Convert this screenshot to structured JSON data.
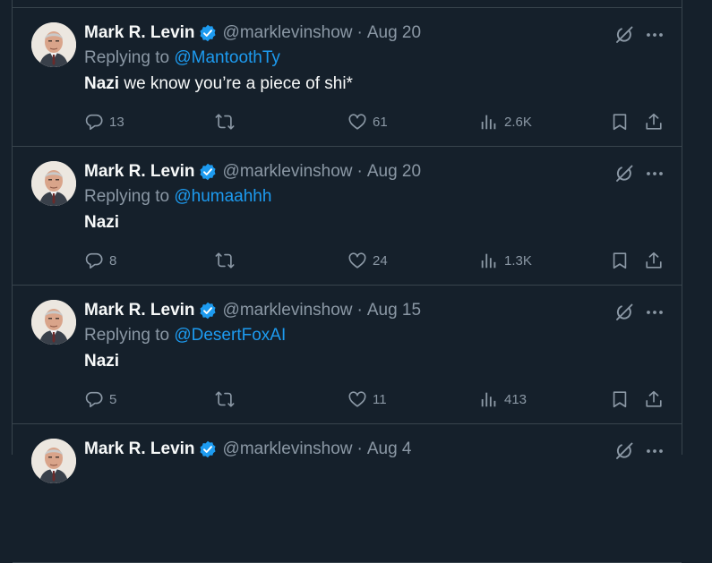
{
  "colors": {
    "background": "#15202b",
    "border": "#38444d",
    "text_primary": "#f7f9f9",
    "text_secondary": "#8b98a5",
    "accent": "#1d9bf0"
  },
  "icons": {
    "verified": "verified-badge-icon",
    "grok": "grok-icon",
    "more": "more-horizontal-icon",
    "reply": "reply-bubble-icon",
    "retweet": "retweet-icon",
    "like": "heart-icon",
    "views": "views-bar-chart-icon",
    "bookmark": "bookmark-icon",
    "share": "share-upload-icon"
  },
  "tweets": [
    {
      "name": "Mark R. Levin",
      "handle": "@marklevinshow",
      "separator": "·",
      "date": "Aug 20",
      "replying_prefix": "Replying to",
      "replying_to": "@MantoothTy",
      "body_bold": "Nazi",
      "body_rest": " we know you’re a piece of shi*",
      "replies": "13",
      "retweets": "",
      "likes": "61",
      "views": "2.6K"
    },
    {
      "name": "Mark R. Levin",
      "handle": "@marklevinshow",
      "separator": "·",
      "date": "Aug 20",
      "replying_prefix": "Replying to",
      "replying_to": "@humaahhh",
      "body_bold": "Nazi",
      "body_rest": "",
      "replies": "8",
      "retweets": "",
      "likes": "24",
      "views": "1.3K"
    },
    {
      "name": "Mark R. Levin",
      "handle": "@marklevinshow",
      "separator": "·",
      "date": "Aug 15",
      "replying_prefix": "Replying to",
      "replying_to": "@DesertFoxAI",
      "body_bold": "Nazi",
      "body_rest": "",
      "replies": "5",
      "retweets": "",
      "likes": "11",
      "views": "413"
    },
    {
      "name": "Mark R. Levin",
      "handle": "@marklevinshow",
      "separator": "·",
      "date": "Aug 4"
    }
  ]
}
